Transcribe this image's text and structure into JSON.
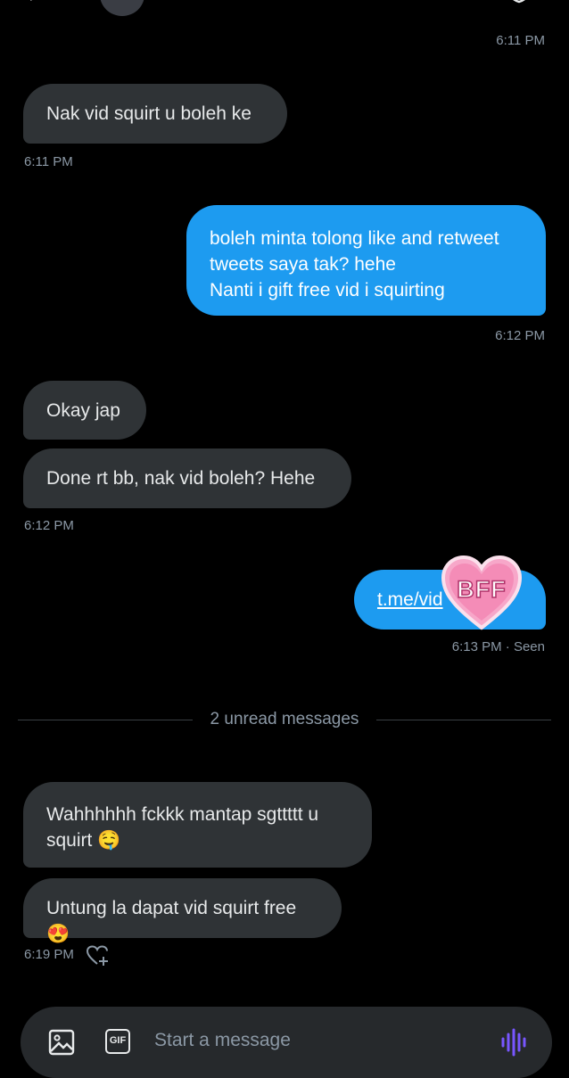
{
  "conversation": {
    "messages": [
      {
        "id": "m0",
        "time": "6:11 PM"
      },
      {
        "id": "m1",
        "dir": "in",
        "text": "Nak vid squirt u boleh ke",
        "time": "6:11 PM"
      },
      {
        "id": "m2",
        "dir": "out",
        "text": "boleh minta tolong like and retweet\ntweets saya tak? hehe\nNanti i gift free vid i squirting",
        "time": "6:12 PM"
      },
      {
        "id": "m3",
        "dir": "in",
        "text": "Okay jap"
      },
      {
        "id": "m4",
        "dir": "in",
        "text": "Done rt bb, nak vid boleh? Hehe",
        "time": "6:12 PM"
      },
      {
        "id": "m5",
        "dir": "out",
        "text": "t.me/vid",
        "time": "6:13 PM · Seen"
      },
      {
        "id": "m6",
        "dir": "in",
        "text": "Wahhhhhh fckkk mantap sgttttt u\nsquirt 🤤"
      },
      {
        "id": "m7",
        "dir": "in",
        "text": "Untung la dapat vid squirt free 😍",
        "time": "6:19 PM"
      }
    ],
    "unread_label": "2 unread messages",
    "sticker_text": "BFF"
  },
  "composer": {
    "placeholder": "Start a message",
    "gif_label": "GIF"
  },
  "colors": {
    "background": "#000000",
    "incoming_bubble": "#2f3336",
    "outgoing_bubble": "#1d9bf0",
    "accent_voice": "#7856ff"
  },
  "icons": [
    "back-arrow-icon",
    "avatar",
    "info-icon",
    "shield-icon",
    "add-reaction-icon",
    "image-icon",
    "gif-icon",
    "voice-icon"
  ]
}
